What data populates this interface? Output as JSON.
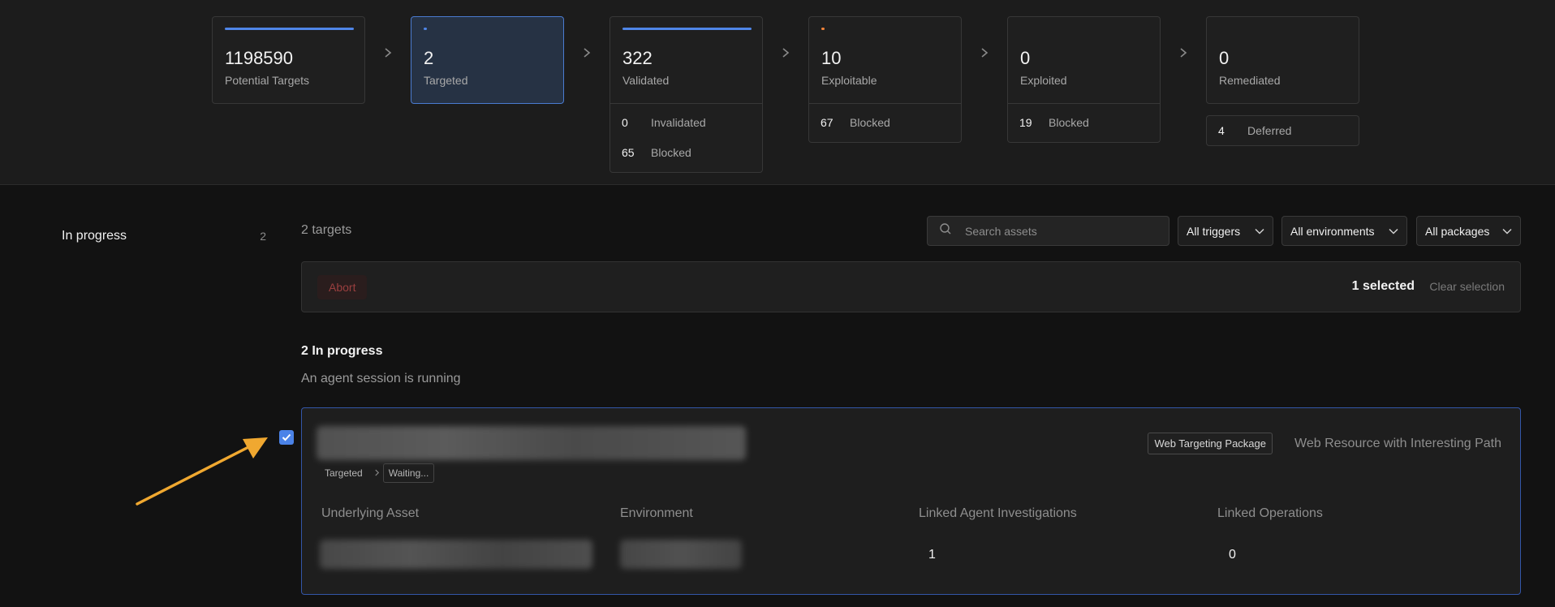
{
  "pipeline": {
    "stages": [
      {
        "count": "1198590",
        "label": "Potential Targets"
      },
      {
        "count": "2",
        "label": "Targeted"
      },
      {
        "count": "322",
        "label": "Validated",
        "sub": [
          {
            "num": "0",
            "label": "Invalidated"
          },
          {
            "num": "65",
            "label": "Blocked"
          }
        ]
      },
      {
        "count": "10",
        "label": "Exploitable",
        "sub": [
          {
            "num": "67",
            "label": "Blocked"
          }
        ]
      },
      {
        "count": "0",
        "label": "Exploited",
        "sub": [
          {
            "num": "19",
            "label": "Blocked"
          }
        ]
      },
      {
        "count": "0",
        "label": "Remediated",
        "deferred": {
          "num": "4",
          "label": "Deferred"
        }
      }
    ],
    "colors": {
      "bar_blue": "#4f86e8",
      "bar_orange": "#f0833a",
      "active_border": "#4a7bd0"
    }
  },
  "sidebar": {
    "items": [
      {
        "label": "In progress",
        "count": "2"
      }
    ]
  },
  "toolbar": {
    "targets_count": "2 targets",
    "search_placeholder": "Search assets",
    "filters": [
      "All triggers",
      "All environments",
      "All packages"
    ]
  },
  "selection_bar": {
    "abort_label": "Abort",
    "selected_text": "1 selected",
    "clear_label": "Clear selection"
  },
  "section": {
    "title": "2 In progress",
    "subtitle": "An agent session is running"
  },
  "target_card": {
    "checked": true,
    "breadcrumb": [
      "Targeted",
      "Waiting..."
    ],
    "package_badge": "Web Targeting Package",
    "package_desc": "Web Resource with Interesting Path",
    "columns": [
      {
        "header": "Underlying Asset",
        "value": ""
      },
      {
        "header": "Environment",
        "value": ""
      },
      {
        "header": "Linked Agent Investigations",
        "value": "1"
      },
      {
        "header": "Linked Operations",
        "value": "0"
      }
    ]
  },
  "annotation": {
    "arrow_color": "#f0a830"
  }
}
